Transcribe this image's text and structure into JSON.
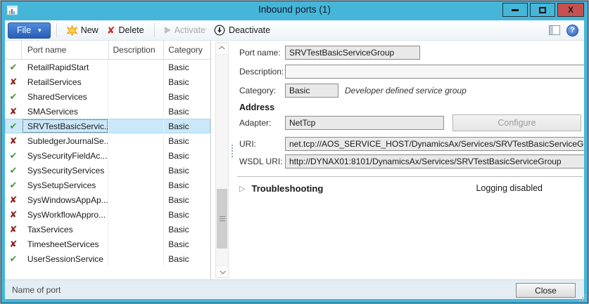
{
  "titlebar": {
    "title": "Inbound ports (1)"
  },
  "icons": {
    "close_window": "X",
    "file_caret": "▾",
    "delete_x": "✘",
    "expander": "▷",
    "help": "?"
  },
  "toolbar": {
    "file": "File",
    "new": "New",
    "delete": "Delete",
    "activate": "Activate",
    "deactivate": "Deactivate"
  },
  "grid": {
    "columns": {
      "status": "",
      "port_name": "Port name",
      "description": "Description",
      "category": "Category"
    },
    "status_icons": {
      "active": "✔",
      "inactive": "✘"
    },
    "rows": [
      {
        "status": "active",
        "port_name": "RetailRapidStart",
        "description": "",
        "category": "Basic",
        "selected": false
      },
      {
        "status": "inactive",
        "port_name": "RetailServices",
        "description": "",
        "category": "Basic",
        "selected": false
      },
      {
        "status": "active",
        "port_name": "SharedServices",
        "description": "",
        "category": "Basic",
        "selected": false
      },
      {
        "status": "inactive",
        "port_name": "SMAServices",
        "description": "",
        "category": "Basic",
        "selected": false
      },
      {
        "status": "active",
        "port_name": "SRVTestBasicServic...",
        "description": "",
        "category": "Basic",
        "selected": true
      },
      {
        "status": "inactive",
        "port_name": "SubledgerJournalSe...",
        "description": "",
        "category": "Basic",
        "selected": false
      },
      {
        "status": "active",
        "port_name": "SysSecurityFieldAc...",
        "description": "",
        "category": "Basic",
        "selected": false
      },
      {
        "status": "active",
        "port_name": "SysSecurityServices",
        "description": "",
        "category": "Basic",
        "selected": false
      },
      {
        "status": "active",
        "port_name": "SysSetupServices",
        "description": "",
        "category": "Basic",
        "selected": false
      },
      {
        "status": "inactive",
        "port_name": "SysWindowsAppAp...",
        "description": "",
        "category": "Basic",
        "selected": false
      },
      {
        "status": "inactive",
        "port_name": "SysWorkflowAppro...",
        "description": "",
        "category": "Basic",
        "selected": false
      },
      {
        "status": "inactive",
        "port_name": "TaxServices",
        "description": "",
        "category": "Basic",
        "selected": false
      },
      {
        "status": "inactive",
        "port_name": "TimesheetServices",
        "description": "",
        "category": "Basic",
        "selected": false
      },
      {
        "status": "active",
        "port_name": "UserSessionService",
        "description": "",
        "category": "Basic",
        "selected": false
      }
    ]
  },
  "details": {
    "port_name": {
      "label": "Port name:",
      "value": "SRVTestBasicServiceGroup"
    },
    "description": {
      "label": "Description:",
      "value": ""
    },
    "category": {
      "label": "Category:",
      "value": "Basic",
      "note": "Developer defined service group"
    },
    "address_header": "Address",
    "adapter": {
      "label": "Adapter:",
      "value": "NetTcp",
      "configure_label": "Configure"
    },
    "uri": {
      "label": "URI:",
      "value": "net.tcp://AOS_SERVICE_HOST/DynamicsAx/Services/SRVTestBasicServiceGroup"
    },
    "wsdl_uri": {
      "label": "WSDL URI:",
      "value": "http://DYNAX01:8101/DynamicsAx/Services/SRVTestBasicServiceGroup"
    },
    "troubleshooting": {
      "label": "Troubleshooting",
      "status": "Logging disabled"
    }
  },
  "statusbar": {
    "text": "Name of port",
    "close": "Close"
  },
  "colors": {
    "frame": "#45b6d8",
    "frame-border": "#1e4e63",
    "close-red": "#c75050",
    "selection": "#cbe8f9",
    "check-green": "#3f9c35",
    "x-red": "#8e2424",
    "input-bg": "#e9e9e9",
    "input-border": "#8c8c8c"
  }
}
